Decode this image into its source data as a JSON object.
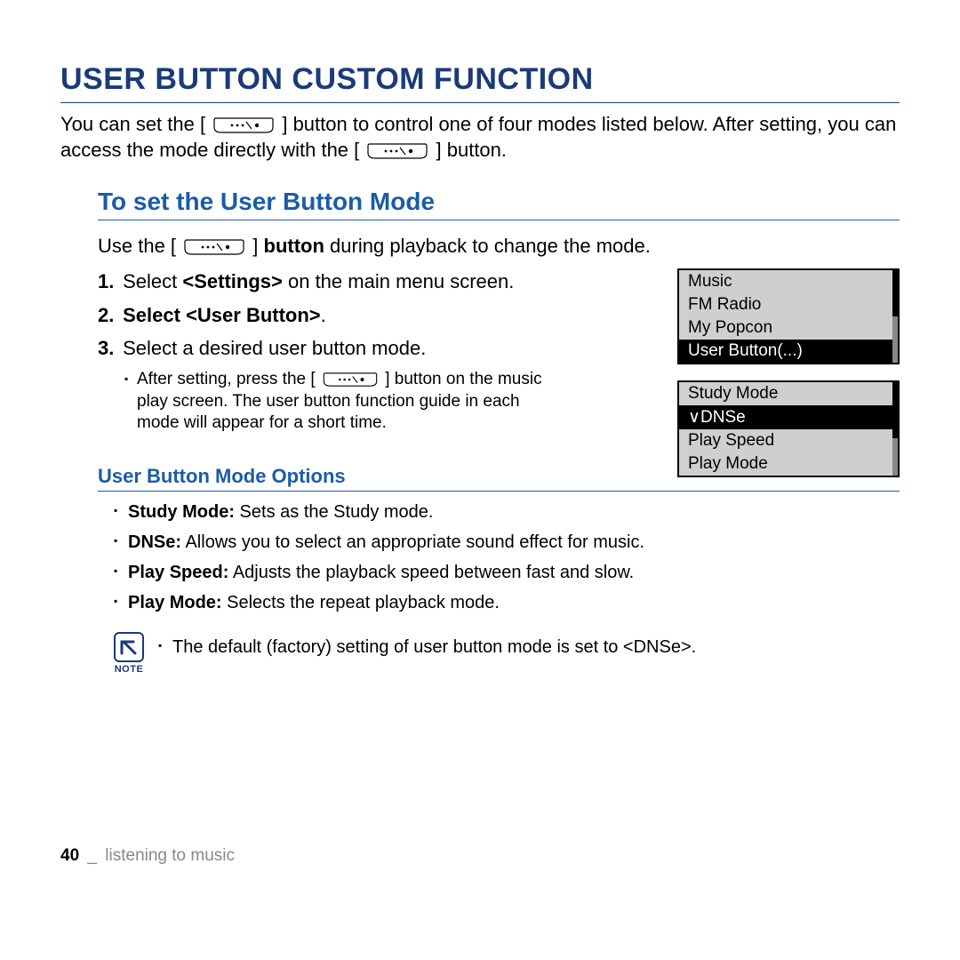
{
  "title": "USER BUTTON CUSTOM FUNCTION",
  "intro": {
    "p1a": "You can set the [",
    "p1b": "] button to control one of four modes listed below. After setting, you can access the mode directly with the [",
    "p1c": "] button."
  },
  "section1": {
    "title": "To set the User Button Mode",
    "lead_a": "Use the [",
    "lead_b": "] ",
    "lead_bold": "button",
    "lead_c": " during playback to change the mode.",
    "steps": {
      "s1_num": "1.",
      "s1_a": "Select ",
      "s1_bold": "<Settings>",
      "s1_b": " on the main menu screen.",
      "s2_num": "2.",
      "s2_a": "Select ",
      "s2_bold": "<User Button>",
      "s2_b": ".",
      "s3_num": "3.",
      "s3_a": "Select a desired user button mode.",
      "bullet_a": "After setting, press the [",
      "bullet_b": "] button on the music play screen. The user button function guide in each mode will appear for a short time."
    }
  },
  "screen1": {
    "i1": "Music",
    "i2": "FM Radio",
    "i3": "My Popcon",
    "i4": "User Button(...)"
  },
  "screen2": {
    "i1": "Study Mode",
    "i2_check": "∨",
    "i2": "DNSe",
    "i3": "Play Speed",
    "i4": "Play Mode"
  },
  "options": {
    "title": "User Button Mode Options",
    "o1_b": "Study Mode:",
    "o1": " Sets as the Study mode.",
    "o2_b": "DNSe:",
    "o2": " Allows you to select an appropriate sound effect for music.",
    "o3_b": "Play Speed:",
    "o3": " Adjusts the playback speed between fast and slow.",
    "o4_b": "Play Mode:",
    "o4": " Selects the repeat playback mode."
  },
  "note": {
    "label": "NOTE",
    "text": "The default (factory) setting of user button mode is set to <DNSe>."
  },
  "footer": {
    "page": "40",
    "sep": "_",
    "section": "listening to music"
  }
}
